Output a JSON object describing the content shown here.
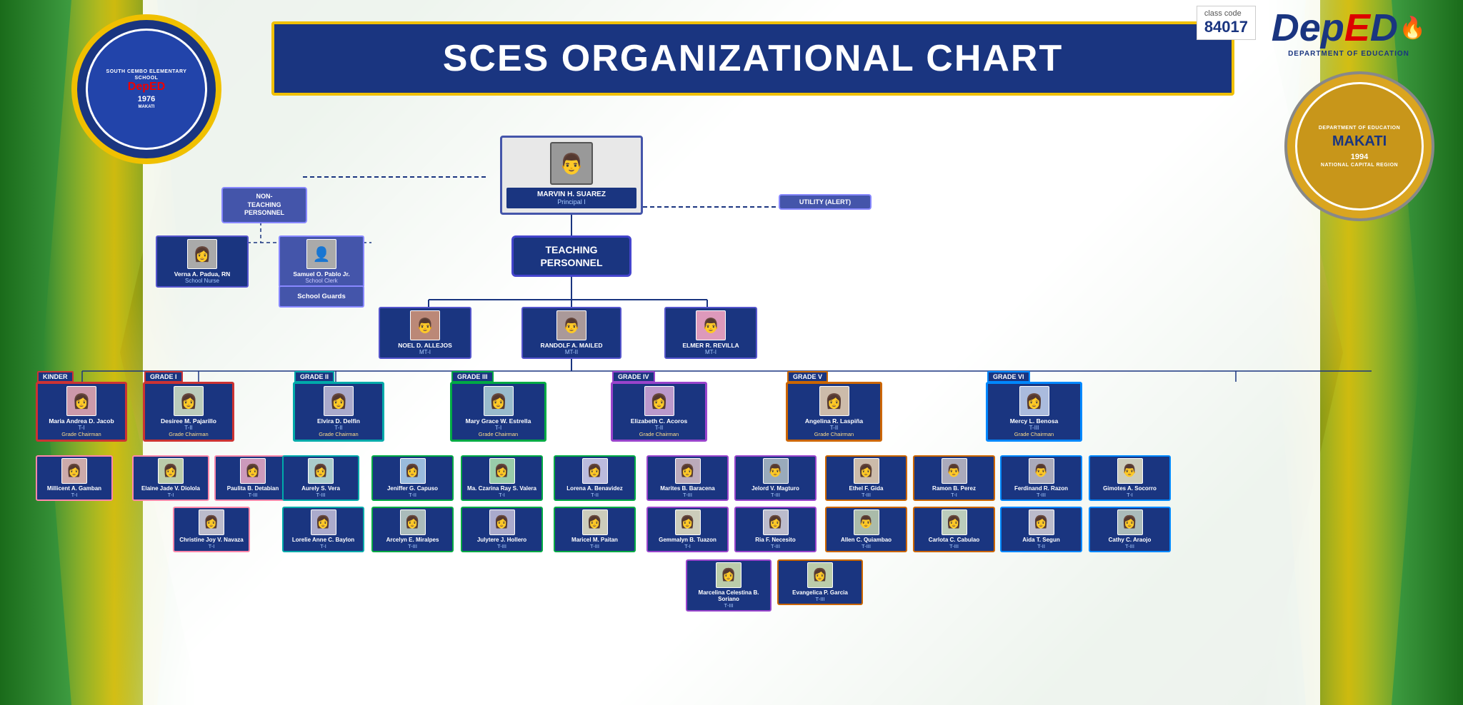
{
  "page": {
    "title": "SCES ORGANIZATIONAL CHART",
    "school_name": "SOUTH CEMBO ELEMENTARY SCHOOL",
    "school_year": "1976",
    "class_code_label": "class code",
    "class_code": "84017",
    "deped_label": "DepED",
    "deped_sub": "DEPARTMENT OF EDUCATION",
    "makati_label": "MAKATI",
    "makati_year": "1994",
    "makati_sub": "NATIONAL CAPITAL REGION",
    "makati_sub2": "DEPARTMENT OF EDUCATION"
  },
  "principal": {
    "name": "MARVIN H. SUAREZ",
    "role": "Principal I"
  },
  "non_teaching": {
    "label": "NON-\nTEACHING\nPERSONNEL",
    "utility_label": "UTILITY (ALERT)"
  },
  "staff": [
    {
      "name": "Verna A. Padua, RN",
      "role": "School Nurse"
    },
    {
      "name": "Samuel O. Pablo Jr.",
      "role": "School Clerk"
    },
    {
      "name": "School Guards",
      "role": ""
    }
  ],
  "teaching_personnel": "TEACHING\nPERSONNEL",
  "mt_staff": [
    {
      "name": "NOEL D. ALLEJOS",
      "role": "MT-I"
    },
    {
      "name": "RANDOLF A. MAILED",
      "role": "MT-II"
    },
    {
      "name": "ELMER R. REVILLA",
      "role": "MT-I"
    }
  ],
  "grades": [
    {
      "label": "KINDER",
      "chairman": {
        "name": "Maria Andrea D. Jacob",
        "rank": "T-I",
        "title": "Grade Chairman"
      },
      "teachers": [
        {
          "name": "Millicent A. Gamban",
          "rank": "T-I"
        }
      ]
    },
    {
      "label": "GRADE I",
      "chairman": {
        "name": "Desiree M. Pajarillo",
        "rank": "T-II",
        "title": "Grade Chairman"
      },
      "teachers": [
        {
          "name": "Elaine Jade V. Diolola",
          "rank": "T-I"
        },
        {
          "name": "Paulita B. Detabian",
          "rank": "T-III"
        },
        {
          "name": "Christine Joy V. Navaza",
          "rank": "T-I"
        }
      ]
    },
    {
      "label": "GRADE II",
      "chairman": {
        "name": "Elvira D. Delfin",
        "rank": "T-II",
        "title": "Grade Chairman"
      },
      "teachers": [
        {
          "name": "Aurely S. Vera",
          "rank": "T-III"
        },
        {
          "name": "Lorelie Anne C. Baylon",
          "rank": "T-I"
        }
      ]
    },
    {
      "label": "GRADE III",
      "chairman": {
        "name": "Mary Grace W. Estrella",
        "rank": "T-I",
        "title": "Grade Chairman"
      },
      "teachers": [
        {
          "name": "Jeniffer G. Capuso",
          "rank": "T-II"
        },
        {
          "name": "Arcelyn E. Miralpes",
          "rank": "T-III"
        },
        {
          "name": "Ma. Czarina Ray S. Valera",
          "rank": "T-I"
        },
        {
          "name": "Julytere J. Hollero",
          "rank": "T-III"
        },
        {
          "name": "Lorena A. Benavidez",
          "rank": "T-II"
        },
        {
          "name": "Maricel M. Paitan",
          "rank": "T-III"
        }
      ]
    },
    {
      "label": "GRADE IV",
      "chairman": {
        "name": "Elizabeth C. Acoros",
        "rank": "T-II",
        "title": "Grade Chairman"
      },
      "teachers": [
        {
          "name": "Marites B. Baracena",
          "rank": "T-III"
        },
        {
          "name": "Jelord V. Magturo",
          "rank": "T-III"
        },
        {
          "name": "Gemmalyn B. Tuazon",
          "rank": "T-I"
        },
        {
          "name": "Ria F. Necesito",
          "rank": "T-III"
        },
        {
          "name": "Marcelina Celestina B. Soriano",
          "rank": "T-III"
        }
      ]
    },
    {
      "label": "GRADE V",
      "chairman": {
        "name": "Angelina R. Laspiña",
        "rank": "T-II",
        "title": "Grade Chairman"
      },
      "teachers": [
        {
          "name": "Ethel F. Gida",
          "rank": "T-III"
        },
        {
          "name": "Allen C. Quiambao",
          "rank": "T-III"
        },
        {
          "name": "Ramon B. Perez",
          "rank": "T-I"
        },
        {
          "name": "Carlota C. Cabulao",
          "rank": "T-III"
        },
        {
          "name": "Evangelica P. Garcia",
          "rank": "T-III"
        }
      ]
    },
    {
      "label": "GRADE VI",
      "chairman": {
        "name": "Mercy L. Benosa",
        "rank": "T-III",
        "title": "Grade Chairman"
      },
      "teachers": [
        {
          "name": "Ferdinand R. Razon",
          "rank": "T-III"
        },
        {
          "name": "Aida T. Segun",
          "rank": "T-II"
        },
        {
          "name": "Gimotes A. Socorro",
          "rank": "T-I"
        },
        {
          "name": "Cathy C. Araojo",
          "rank": "T-III"
        }
      ]
    }
  ]
}
